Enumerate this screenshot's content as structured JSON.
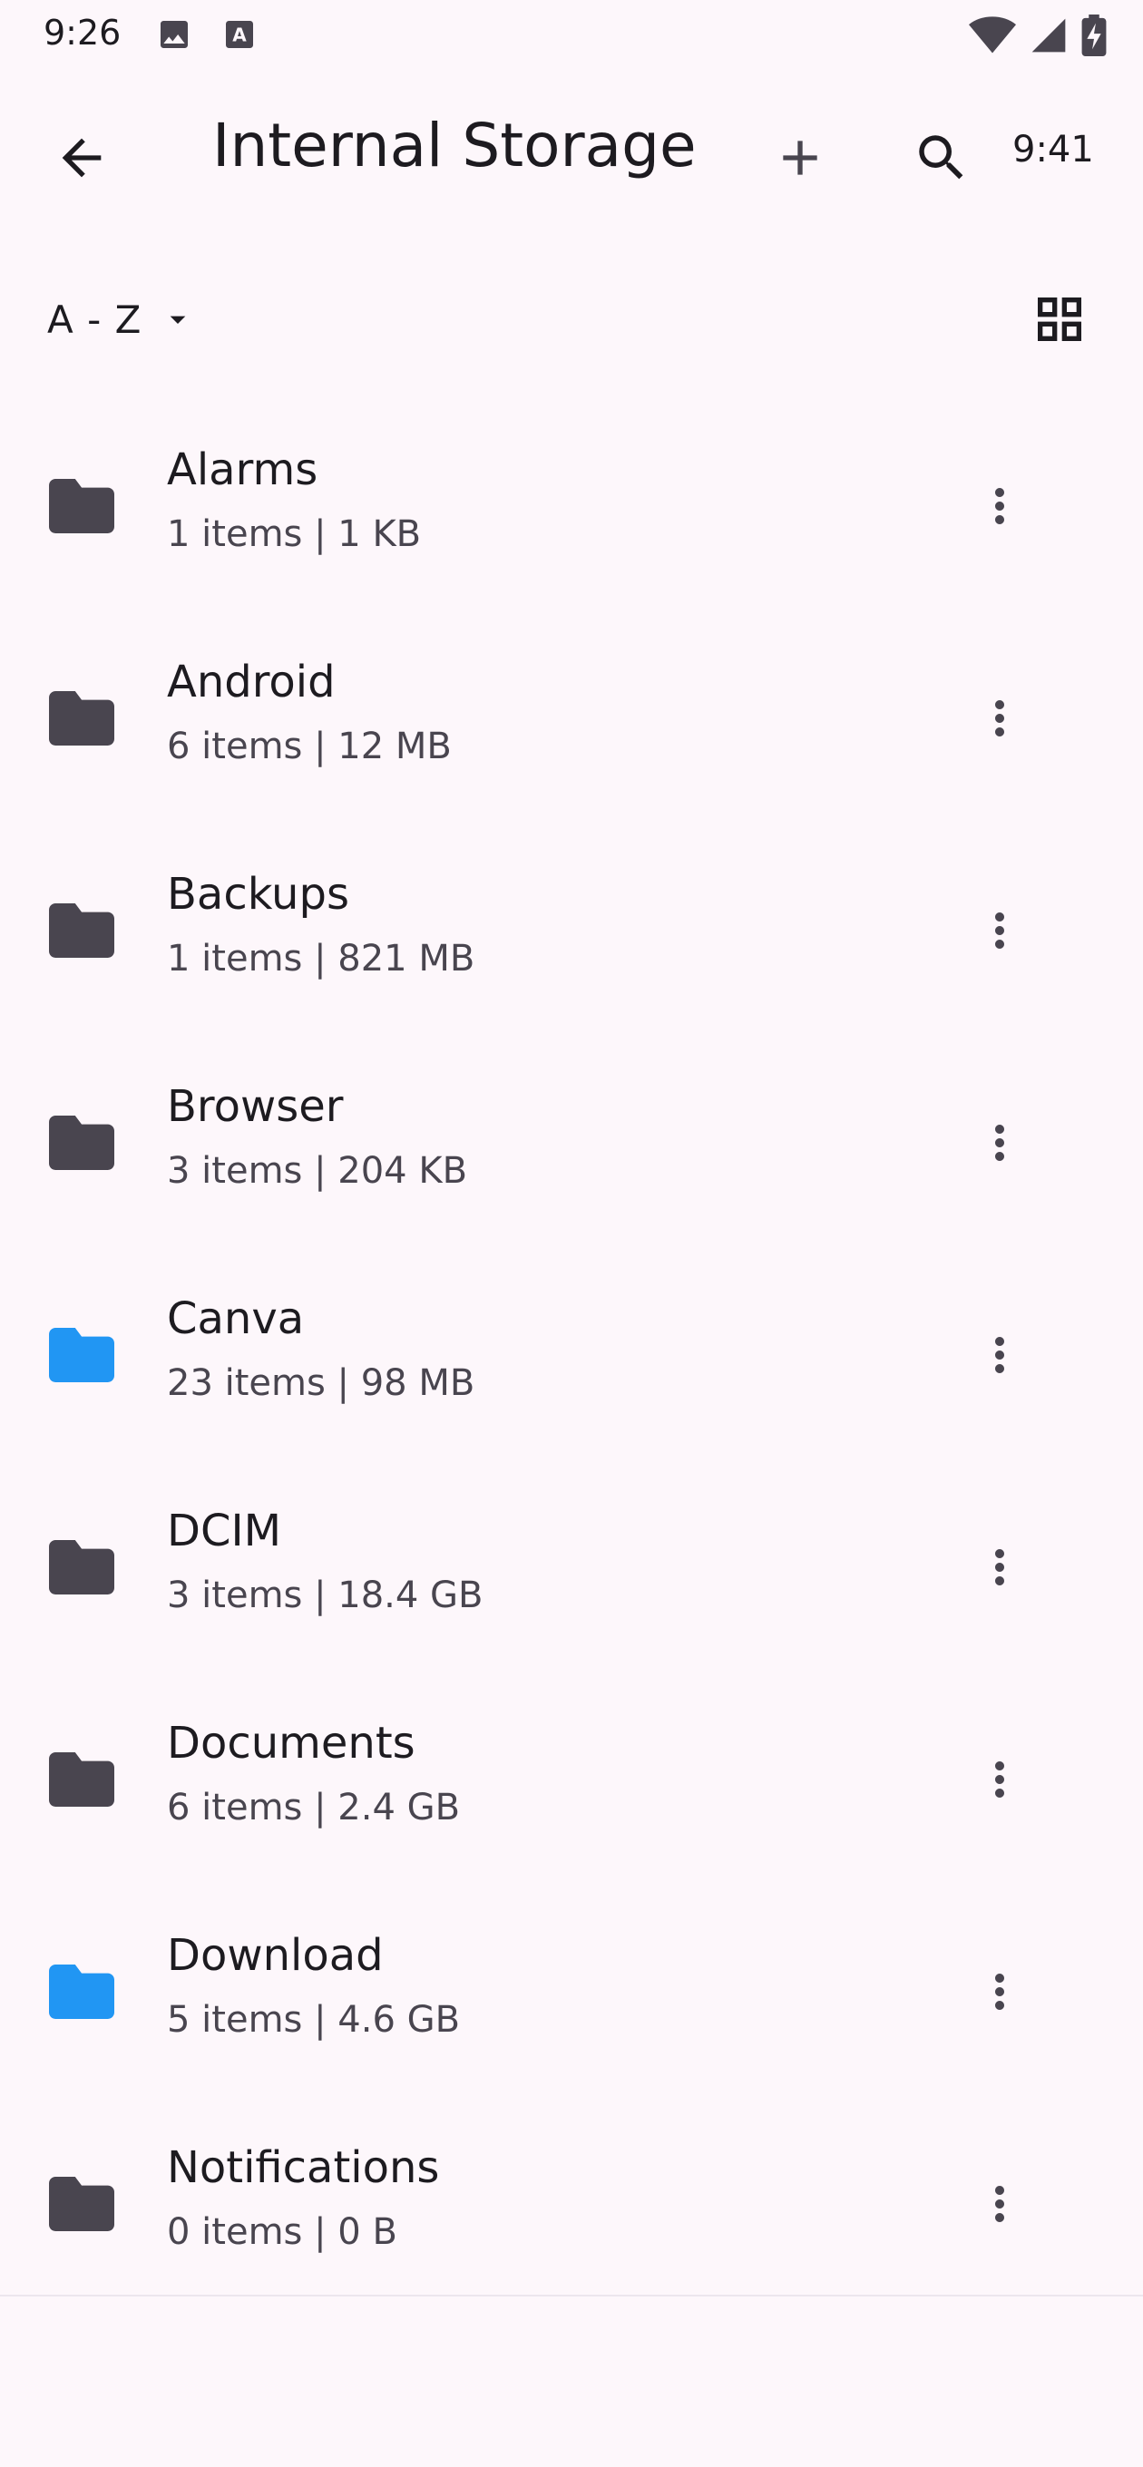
{
  "status_bar": {
    "time": "9:26",
    "left_icons": [
      "image-icon",
      "keyboard-a-icon"
    ],
    "right_icons": [
      "wifi-icon",
      "cellular-signal-icon",
      "battery-charging-icon"
    ]
  },
  "app_bar": {
    "title": "Internal Storage",
    "time": "9:41",
    "back_icon": "arrow-left-icon",
    "add_icon": "plus-icon",
    "search_icon": "search-icon"
  },
  "sort": {
    "label": "A - Z",
    "view_toggle_icon": "grid-view-icon"
  },
  "colors": {
    "background": "#fdf7fb",
    "text_primary": "#1d1b20",
    "text_secondary": "#49454f",
    "folder_default": "#49454f",
    "folder_highlight": "#2196f3"
  },
  "folders": [
    {
      "name": "Alarms",
      "meta": "1 items | 1 KB",
      "color": "#49454f"
    },
    {
      "name": "Android",
      "meta": "6 items | 12 MB",
      "color": "#49454f"
    },
    {
      "name": "Backups",
      "meta": "1 items | 821 MB",
      "color": "#49454f"
    },
    {
      "name": "Browser",
      "meta": "3 items | 204 KB",
      "color": "#49454f"
    },
    {
      "name": "Canva",
      "meta": "23 items | 98 MB",
      "color": "#2196f3"
    },
    {
      "name": "DCIM",
      "meta": "3 items | 18.4 GB",
      "color": "#49454f"
    },
    {
      "name": "Documents",
      "meta": "6 items | 2.4 GB",
      "color": "#49454f"
    },
    {
      "name": "Download",
      "meta": "5 items | 4.6 GB",
      "color": "#2196f3"
    },
    {
      "name": "Notifications",
      "meta": "0 items | 0 B",
      "color": "#49454f"
    }
  ]
}
